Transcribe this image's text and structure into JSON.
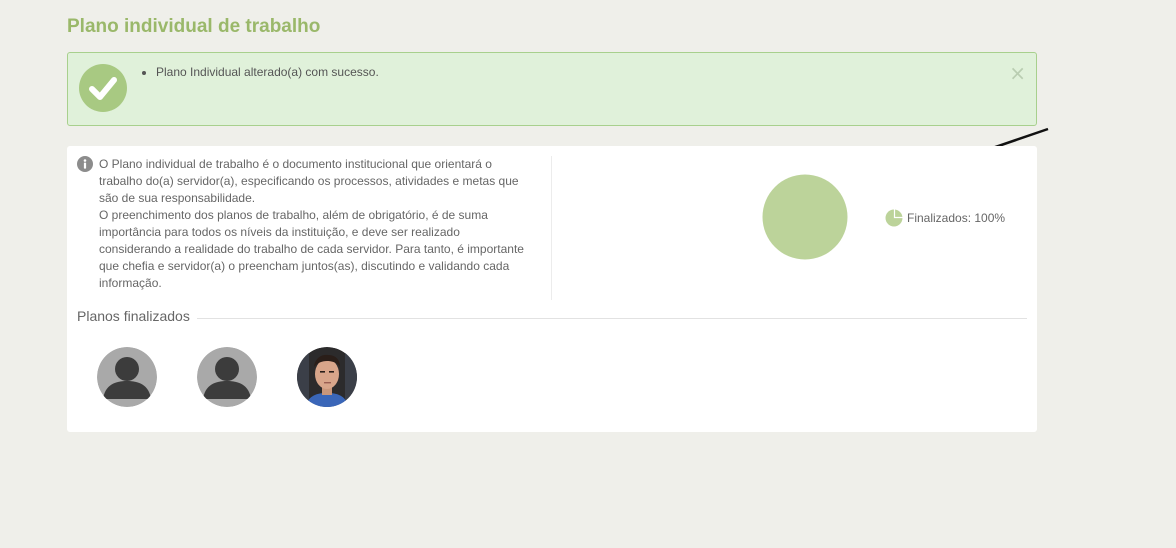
{
  "page": {
    "title": "Plano individual de trabalho"
  },
  "alert": {
    "message": "Plano Individual alterado(a) com sucesso.",
    "close_glyph": "×"
  },
  "info": {
    "paragraph1": "O Plano individual de trabalho é o documento institucional que orientará o trabalho do(a) servidor(a), especificando os processos, atividades e metas que são de sua responsabilidade.",
    "paragraph2": "O preenchimento dos planos de trabalho, além de obrigatório, é de suma importância para todos os níveis da instituição, e deve ser realizado considerando a realidade do trabalho de cada servidor. Para tanto, é importante que chefia e servidor(a) o preencham juntos(as), discutindo e validando cada informação."
  },
  "chart_data": {
    "type": "pie",
    "slices": [
      {
        "name": "Finalizados",
        "value": 100,
        "color": "#bcd39a"
      }
    ],
    "legend": [
      {
        "label": "Finalizados: 100%"
      }
    ],
    "legend_position": "right"
  },
  "planos": {
    "title": "Planos finalizados",
    "avatars": [
      {
        "type": "placeholder",
        "icon": "user-placeholder-icon"
      },
      {
        "type": "placeholder",
        "icon": "user-placeholder-icon"
      },
      {
        "type": "photo",
        "icon": "user-photo"
      }
    ]
  },
  "colors": {
    "accent": "#9ab86a",
    "alert_bg": "#e0f1da",
    "alert_border": "#a8d08d",
    "pie": "#bcd39a"
  }
}
